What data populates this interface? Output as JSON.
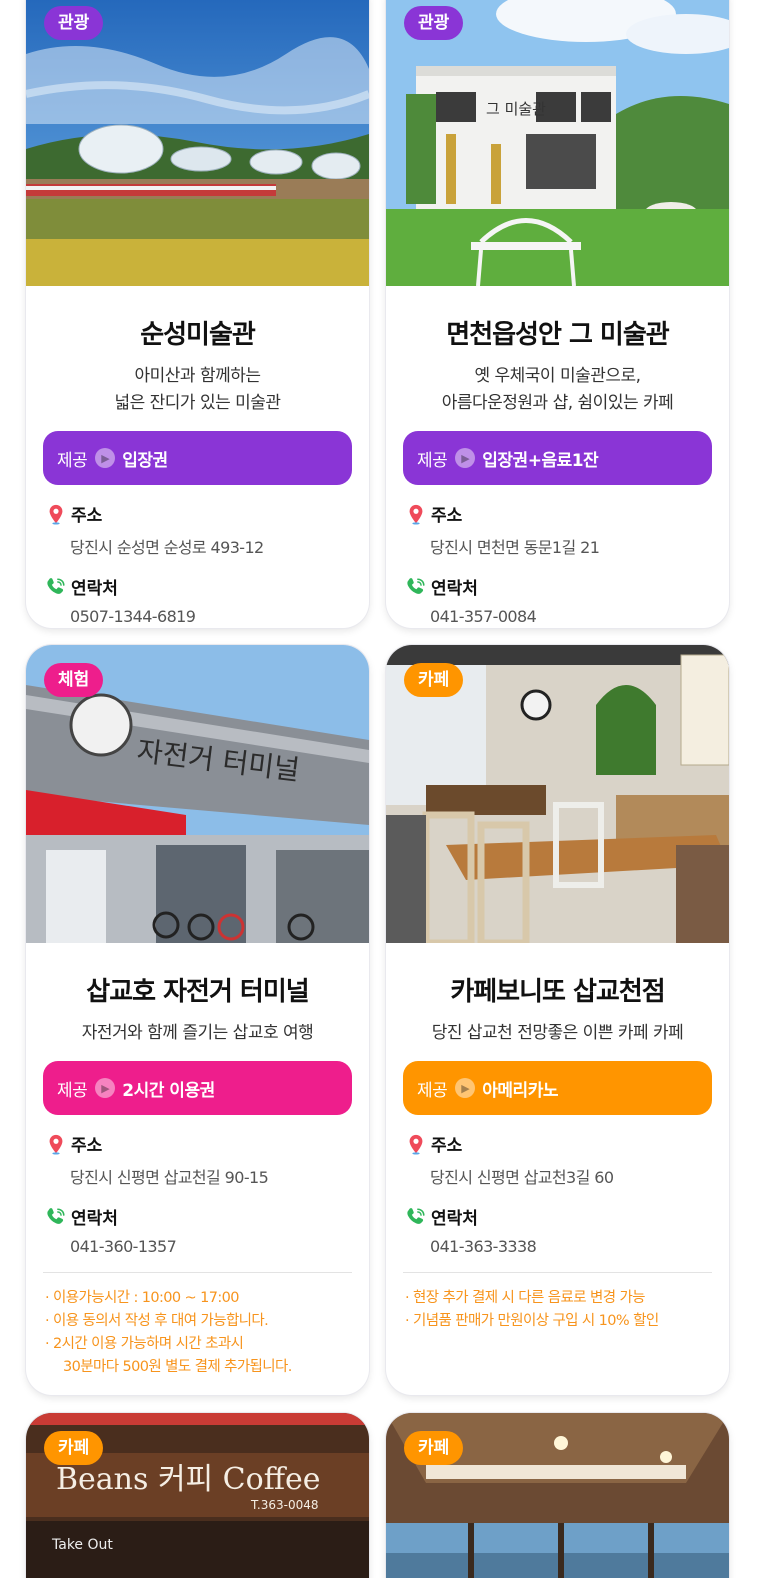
{
  "labels": {
    "offer": "제공",
    "address": "주소",
    "contact": "연락처"
  },
  "colors": {
    "purple": "#8a35d6",
    "pink": "#ee1e8c",
    "orange": "#ff9500",
    "note": "#f7941d"
  },
  "cards": [
    {
      "category": "관광",
      "title": "순성미술관",
      "desc_line1": "아미산과 함께하는",
      "desc_line2": "넓은 잔디가 있는 미술관",
      "offer": "입장권",
      "address": "당진시 순성면 순성로 493-12",
      "phone": "0507-1344-6819"
    },
    {
      "category": "관광",
      "title": "면천읍성안 그 미술관",
      "desc_line1": "옛 우체국이 미술관으로,",
      "desc_line2": "아름다운정원과 샵, 쉼이있는 카페",
      "offer": "입장권+음료1잔",
      "address": "당진시 면천면 동문1길 21",
      "phone": "041-357-0084"
    },
    {
      "category": "체험",
      "title": "삽교호 자전거 터미널",
      "desc_line1": "자전거와 함께 즐기는 삽교호 여행",
      "offer": "2시간 이용권",
      "address": "당진시 신평면 삽교천길 90-15",
      "phone": "041-360-1357",
      "notes": [
        "· 이용가능시간 : 10:00 ~ 17:00",
        "· 이용 동의서 작성 후 대여 가능합니다.",
        "· 2시간 이용 가능하며 시간 초과시",
        "30분마다 500원 별도 결제 추가됩니다."
      ]
    },
    {
      "category": "카페",
      "title": "카페보니또 삽교천점",
      "desc_line1": "당진 삽교천 전망좋은 이쁜 카페 카페",
      "offer": "아메리카노",
      "address": "당진시 신평면 삽교천3길 60",
      "phone": "041-363-3338",
      "notes": [
        "· 현장 추가 결제 시 다른 음료로 변경 가능",
        "· 기념품 판매가 만원이상 구입 시 10% 할인"
      ]
    },
    {
      "category": "카페",
      "sign_text": "Beans 커피 Coffee",
      "sign_phone": "T.363-0048",
      "sign_small": "Take Out"
    },
    {
      "category": "카페"
    }
  ]
}
